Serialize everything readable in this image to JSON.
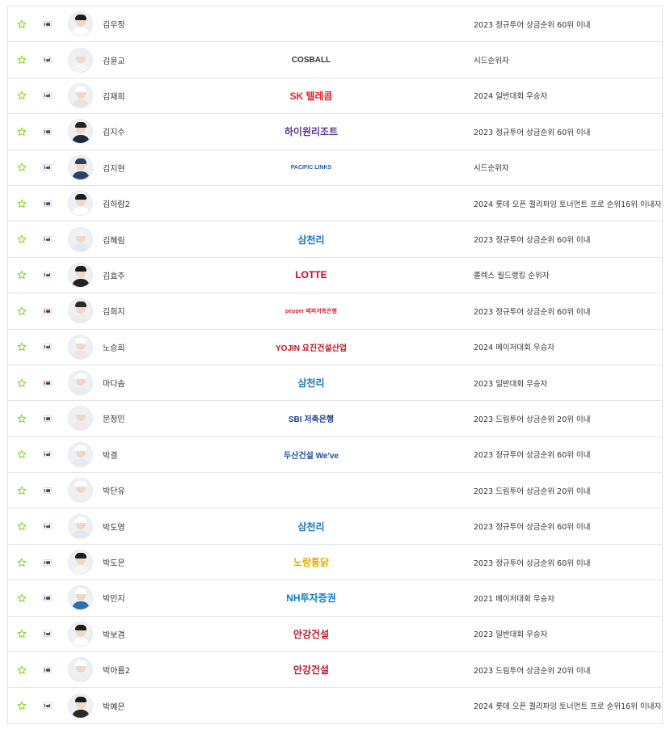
{
  "players": [
    {
      "name": "김우정",
      "sponsor": "",
      "sponsor_color": "",
      "qualification": "2023 정규투어 상금순위 60위 이내",
      "hair": "#1b1b1b",
      "shirt": "#ffffff"
    },
    {
      "name": "김윤교",
      "sponsor": "COSBALL",
      "sponsor_color": "#333333",
      "qualification": "시드순위자",
      "hair": "#eeeeee",
      "shirt": "#f5f5f5"
    },
    {
      "name": "김재희",
      "sponsor": "SK 텔레콤",
      "sponsor_color": "#e6212d",
      "qualification": "2024 일반대회 우승자",
      "hair": "#ffffff",
      "shirt": "#e9e4da"
    },
    {
      "name": "김지수",
      "sponsor": "하이원리조트",
      "sponsor_color": "#5b3a8c",
      "qualification": "2023 정규투어 상금순위 60위 이내",
      "hair": "#222222",
      "shirt": "#202a3a"
    },
    {
      "name": "김지현",
      "sponsor": "PACIFIC LINKS",
      "sponsor_color": "#1a5fa8",
      "qualification": "시드순위자",
      "hair": "#2c3e6b",
      "shirt": "#30406e"
    },
    {
      "name": "김하람2",
      "sponsor": "",
      "sponsor_color": "",
      "qualification": "2024 롯데 오픈 퀄리파잉 토너먼트 프로 순위16위 이내자",
      "hair": "#1b1b1b",
      "shirt": "#ffffff"
    },
    {
      "name": "김혜림",
      "sponsor": "삼천리",
      "sponsor_color": "#1a74b8",
      "qualification": "2023 정규투어 상금순위 60위 이내",
      "hair": "#f2f2f2",
      "shirt": "#dfe9f2"
    },
    {
      "name": "김효주",
      "sponsor": "LOTTE",
      "sponsor_color": "#d6001c",
      "qualification": "롤렉스 월드랭킹 순위자",
      "hair": "#1b1b1b",
      "shirt": "#222222"
    },
    {
      "name": "김희지",
      "sponsor": "pepper 페퍼저축은행",
      "sponsor_color": "#d62a3a",
      "qualification": "2023 정규투어 상금순위 60위 이내",
      "hair": "#2a2a2a",
      "shirt": "#e8f0e6"
    },
    {
      "name": "노승희",
      "sponsor": "YOJIN 요진건설산업",
      "sponsor_color": "#c0141f",
      "qualification": "2024 메이저대회 우승자",
      "hair": "#ffffff",
      "shirt": "#f1e3e6"
    },
    {
      "name": "마다솜",
      "sponsor": "삼천리",
      "sponsor_color": "#1a74b8",
      "qualification": "2023 일반대회 우승자",
      "hair": "#ffffff",
      "shirt": "#e6eef5"
    },
    {
      "name": "문정민",
      "sponsor": "SBI 저축은행",
      "sponsor_color": "#1f3d8f",
      "qualification": "2023 드림투어 상금순위 20위 이내",
      "hair": "#f2f2f2",
      "shirt": "#f4e6ee"
    },
    {
      "name": "박결",
      "sponsor": "두산건설 We've",
      "sponsor_color": "#1e4fa0",
      "qualification": "2023 정규투어 상금순위 60위 이내",
      "hair": "#ffffff",
      "shirt": "#e3ecf5"
    },
    {
      "name": "박단유",
      "sponsor": "",
      "sponsor_color": "",
      "qualification": "2023 드림투어 상금순위 20위 이내",
      "hair": "#ffffff",
      "shirt": "#eeeeee"
    },
    {
      "name": "박도영",
      "sponsor": "삼천리",
      "sponsor_color": "#1a74b8",
      "qualification": "2023 정규투어 상금순위 60위 이내",
      "hair": "#ffffff",
      "shirt": "#dfe9f2"
    },
    {
      "name": "박도은",
      "sponsor": "노랑통닭",
      "sponsor_color": "#e7a800",
      "qualification": "2023 정규투어 상금순위 60위 이내",
      "hair": "#1b1b1b",
      "shirt": "#f5f5f5"
    },
    {
      "name": "박민지",
      "sponsor": "NH투자증권",
      "sponsor_color": "#0a7ec2",
      "qualification": "2021 메이저대회 우승자",
      "hair": "#ffffff",
      "shirt": "#2c6fb3"
    },
    {
      "name": "박보겸",
      "sponsor": "안강건설",
      "sponsor_color": "#b5182a",
      "qualification": "2023 일반대회 우승자",
      "hair": "#1b1b1b",
      "shirt": "#ffffff"
    },
    {
      "name": "박아름2",
      "sponsor": "안강건설",
      "sponsor_color": "#b5182a",
      "qualification": "2023 드림투어 상금순위 20위 이내",
      "hair": "#ffffff",
      "shirt": "#eeeeee"
    },
    {
      "name": "박예은",
      "sponsor": "",
      "sponsor_color": "",
      "qualification": "2024 롯데 오픈 퀄리파잉 토너먼트 프로 순위16위 이내자",
      "hair": "#1b1b1b",
      "shirt": "#2a2a2a"
    }
  ],
  "colors": {
    "star": "#7ed321",
    "border": "#e3e3e3"
  },
  "icons": {
    "favorite": "star-outline-icon",
    "nationality": "korea-flag-icon"
  }
}
